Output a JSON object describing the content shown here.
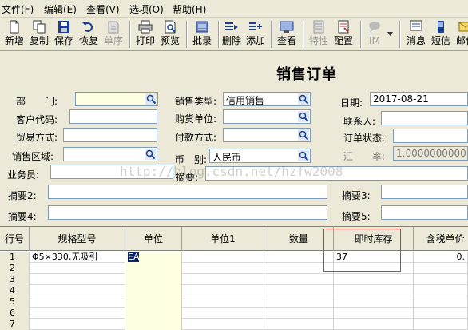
{
  "menu": [
    "文件(F)",
    "编辑(E)",
    "查看(V)",
    "选项(O)",
    "帮助(H)"
  ],
  "toolbar": [
    {
      "label": "新增",
      "icon": "new-doc-icon",
      "enabled": true
    },
    {
      "label": "复制",
      "icon": "copy-icon",
      "enabled": true
    },
    {
      "label": "保存",
      "icon": "save-icon",
      "enabled": true
    },
    {
      "label": "恢复",
      "icon": "undo-icon",
      "enabled": true
    },
    {
      "label": "单序",
      "icon": "sequence-icon",
      "enabled": false
    },
    {
      "label": "打印",
      "icon": "print-icon",
      "enabled": true
    },
    {
      "label": "预览",
      "icon": "preview-icon",
      "enabled": true
    },
    {
      "label": "批录",
      "icon": "batch-entry-icon",
      "enabled": true
    },
    {
      "label": "删除",
      "icon": "delete-row-icon",
      "enabled": true
    },
    {
      "label": "添加",
      "icon": "add-row-icon",
      "enabled": true
    },
    {
      "label": "查看",
      "icon": "view-icon",
      "enabled": true
    },
    {
      "label": "特性",
      "icon": "properties-icon",
      "enabled": false
    },
    {
      "label": "配置",
      "icon": "config-icon",
      "enabled": true
    },
    {
      "label": "IM",
      "icon": "im-chat-icon",
      "enabled": false
    },
    {
      "label": "消息",
      "icon": "message-icon",
      "enabled": true
    },
    {
      "label": "短信",
      "icon": "sms-icon",
      "enabled": true
    },
    {
      "label": "邮件",
      "icon": "mail-icon",
      "enabled": true
    }
  ],
  "form": {
    "title": "销售订单",
    "department_label": "部　　门:",
    "department_value": "",
    "sales_type_label": "销售类型:",
    "sales_type_value": "信用销售",
    "date_label": "日期:",
    "date_value": "2017-08-21",
    "customer_code_label": "客户代码:",
    "customer_code_value": "",
    "purchase_unit_label": "购货单位:",
    "purchase_unit_value": "",
    "contact_label": "联系人:",
    "contact_value": "",
    "trade_mode_label": "贸易方式:",
    "trade_mode_value": "",
    "payment_mode_label": "付款方式:",
    "payment_mode_value": "",
    "order_status_label": "订单状态:",
    "order_status_value": "",
    "sales_region_label": "销售区域:",
    "sales_region_value": "",
    "currency_label": "币　别:",
    "currency_value": "人民币",
    "exchange_rate_label": "汇　　率:",
    "exchange_rate_value": "1.0000000000",
    "salesperson_label": "业务员:",
    "salesperson_value": "",
    "summary_label": "摘要:",
    "summary2_label": "摘要2:",
    "summary3_label": "摘要3:",
    "summary4_label": "摘要4:",
    "summary5_label": "摘要5:",
    "watermark": "http://blog.csdn.net/hzfw2008"
  },
  "grid": {
    "columns": [
      "行号",
      "规格型号",
      "单位",
      "单位1",
      "数量",
      "即时库存",
      "含税单价"
    ],
    "rows": [
      {
        "num": "1",
        "spec": "Φ5×330,无吸引",
        "unit": "EA",
        "unit1": "",
        "qty": "",
        "stock": "37",
        "price": "0."
      },
      {
        "num": "2",
        "spec": "",
        "unit": "",
        "unit1": "",
        "qty": "",
        "stock": "",
        "price": ""
      },
      {
        "num": "3",
        "spec": "",
        "unit": "",
        "unit1": "",
        "qty": "",
        "stock": "",
        "price": ""
      },
      {
        "num": "4",
        "spec": "",
        "unit": "",
        "unit1": "",
        "qty": "",
        "stock": "",
        "price": ""
      },
      {
        "num": "5",
        "spec": "",
        "unit": "",
        "unit1": "",
        "qty": "",
        "stock": "",
        "price": ""
      },
      {
        "num": "6",
        "spec": "",
        "unit": "",
        "unit1": "",
        "qty": "",
        "stock": "",
        "price": ""
      },
      {
        "num": "7",
        "spec": "",
        "unit": "",
        "unit1": "",
        "qty": "",
        "stock": "",
        "price": ""
      }
    ]
  },
  "colors": {
    "highlight_box": "#e03030",
    "field_yellow": "#ffffe1",
    "selection": "#0a246a"
  }
}
